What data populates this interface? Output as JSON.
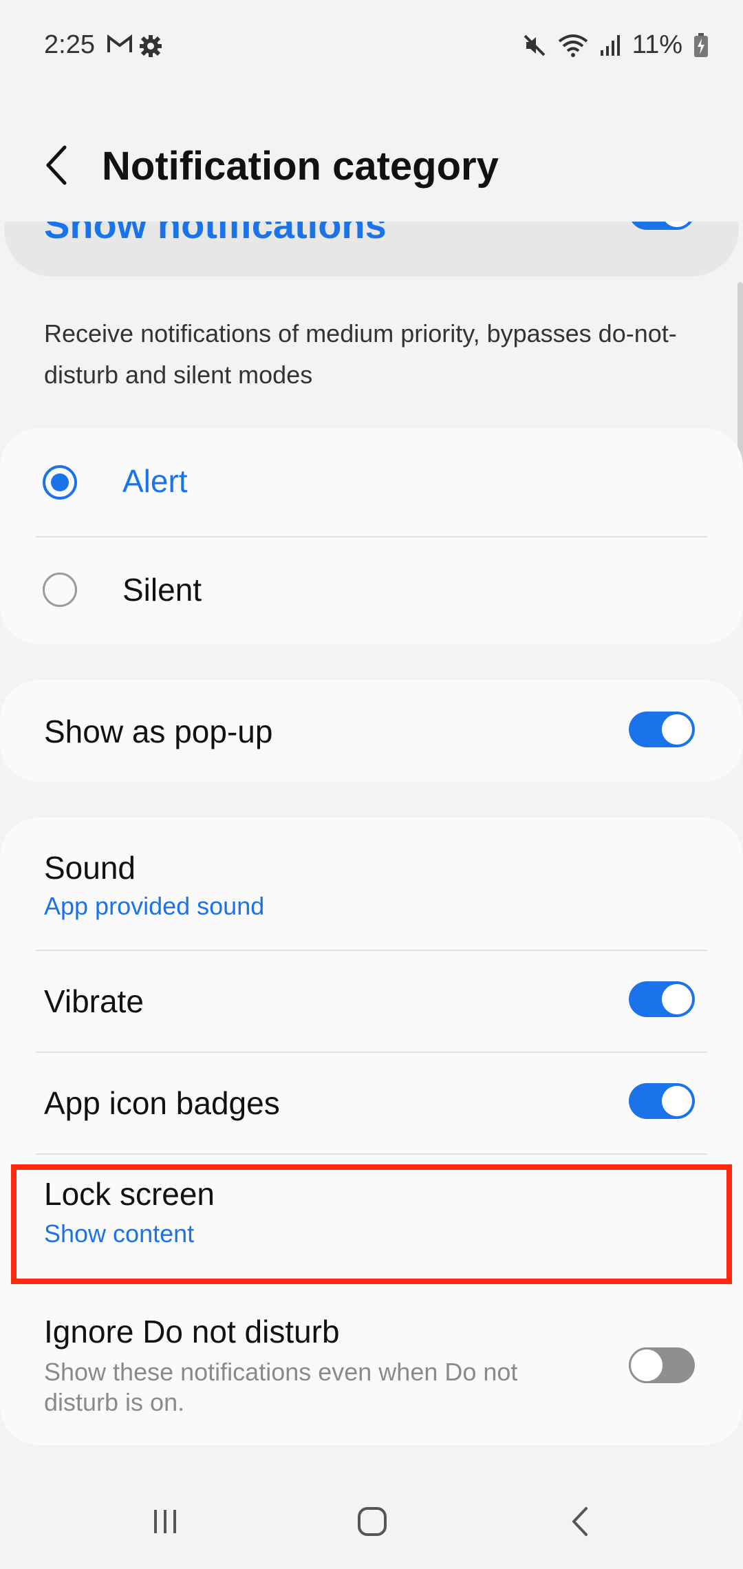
{
  "status_bar": {
    "time": "2:25",
    "battery_percent": "11%",
    "icons": [
      "gmail-icon",
      "gear-icon",
      "mute-icon",
      "wifi-icon",
      "signal-icon",
      "battery-charging-icon"
    ]
  },
  "header": {
    "title": "Notification category",
    "partial_item": "Show notifications"
  },
  "description": "Receive notifications of medium priority, bypasses do-not-disturb and silent modes",
  "mode_options": [
    {
      "label": "Alert",
      "selected": true
    },
    {
      "label": "Silent",
      "selected": false
    }
  ],
  "popup": {
    "label": "Show as pop-up",
    "enabled": true
  },
  "settings": {
    "sound": {
      "label": "Sound",
      "value": "App provided sound"
    },
    "vibrate": {
      "label": "Vibrate",
      "enabled": true
    },
    "badges": {
      "label": "App icon badges",
      "enabled": true
    },
    "lock_screen": {
      "label": "Lock screen",
      "value": "Show content"
    },
    "dnd": {
      "label": "Ignore Do not disturb",
      "description": "Show these notifications even when Do not disturb is on.",
      "enabled": false
    }
  },
  "colors": {
    "accent": "#1a73e8",
    "highlight": "#ff2a10"
  }
}
